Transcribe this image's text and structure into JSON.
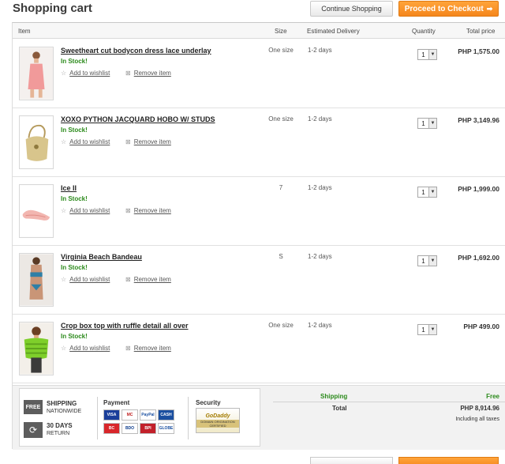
{
  "page_title": "Shopping cart",
  "buttons": {
    "continue_shopping": "Continue Shopping",
    "checkout": "Proceed to Checkout",
    "checkout_arrow": "➡"
  },
  "table_header": {
    "item": "Item",
    "size": "Size",
    "delivery": "Estimated Delivery",
    "quantity": "Quantity",
    "total": "Total price"
  },
  "row_actions": {
    "wishlist_icon": "☆",
    "wishlist": "Add to wishlist",
    "remove_icon": "⊠",
    "remove": "Remove item"
  },
  "items": [
    {
      "name": "Sweetheart cut bodycon dress lace underlay",
      "stock": "In Stock!",
      "size": "One size",
      "delivery": "1-2 days",
      "qty": "1",
      "price": "PHP 1,575.00",
      "image_icon": "dress-icon"
    },
    {
      "name": "XOXO PYTHON JACQUARD HOBO W/ STUDS",
      "stock": "In Stock!",
      "size": "One size",
      "delivery": "1-2 days",
      "qty": "1",
      "price": "PHP 3,149.96",
      "image_icon": "handbag-icon"
    },
    {
      "name": "Ice II",
      "stock": "In Stock!",
      "size": "7",
      "delivery": "1-2 days",
      "qty": "1",
      "price": "PHP 1,999.00",
      "image_icon": "shoe-icon"
    },
    {
      "name": "Virginia Beach Bandeau",
      "stock": "In Stock!",
      "size": "S",
      "delivery": "1-2 days",
      "qty": "1",
      "price": "PHP 1,692.00",
      "image_icon": "bikini-icon"
    },
    {
      "name": "Crop box top with ruffle detail all over",
      "stock": "In Stock!",
      "size": "One size",
      "delivery": "1-2 days",
      "qty": "1",
      "price": "PHP 499.00",
      "image_icon": "top-icon"
    }
  ],
  "badges": {
    "free": "FREE",
    "shipping": "SHIPPING",
    "nationwide": "NATIONWIDE",
    "days": "30 DAYS",
    "return": "RETURN",
    "payment_title": "Payment",
    "payment_logos": [
      "VISA",
      "MC",
      "PayPal",
      "CASH",
      "BC",
      "BDO",
      "BPI",
      "GLOBE"
    ],
    "security_title": "Security",
    "security_badge": "GoDaddy",
    "security_strip": "DOMAIN ORIGINATION CERTIFIED"
  },
  "summary": {
    "shipping_label": "Shipping",
    "shipping_value": "Free",
    "total_label": "Total",
    "total_value": "PHP 8,914.96",
    "taxes": "Including all taxes"
  },
  "colors": {
    "accent": "#f5861c",
    "in_stock": "#2b8a1b"
  }
}
